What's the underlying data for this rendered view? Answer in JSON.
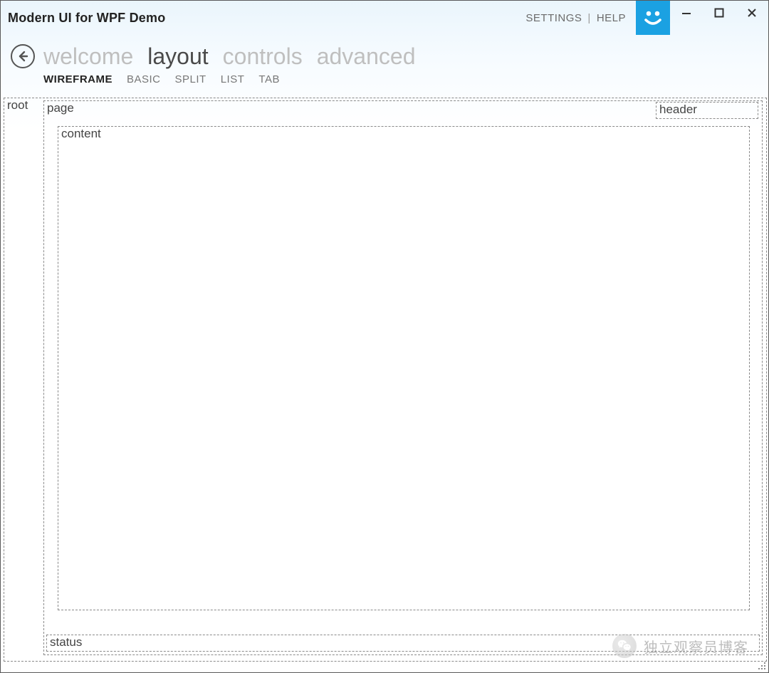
{
  "app": {
    "title": "Modern UI for WPF Demo"
  },
  "titlebar": {
    "settings_label": "SETTINGS",
    "help_label": "HELP",
    "separator": "|"
  },
  "nav": {
    "tabs": [
      {
        "label": "welcome",
        "active": false
      },
      {
        "label": "layout",
        "active": true
      },
      {
        "label": "controls",
        "active": false
      },
      {
        "label": "advanced",
        "active": false
      }
    ]
  },
  "subnav": {
    "tabs": [
      {
        "label": "WIREFRAME",
        "active": true
      },
      {
        "label": "BASIC",
        "active": false
      },
      {
        "label": "SPLIT",
        "active": false
      },
      {
        "label": "LIST",
        "active": false
      },
      {
        "label": "TAB",
        "active": false
      }
    ]
  },
  "wireframe": {
    "root_label": "root",
    "page_label": "page",
    "header_label": "header",
    "content_label": "content",
    "status_label": "status"
  },
  "watermark": {
    "text": "独立观察员博客"
  }
}
